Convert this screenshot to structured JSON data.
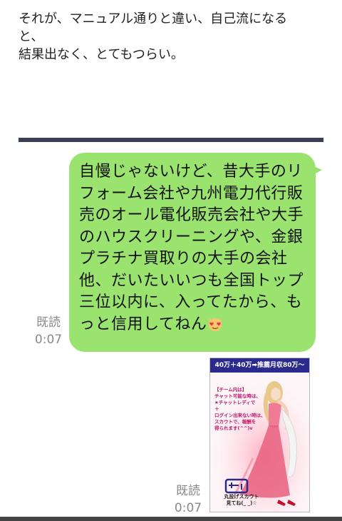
{
  "top_message": {
    "lines": [
      "それが、マニュアル通りと違い、自己流になる",
      "と、",
      "結果出なく、とてもつらい。"
    ]
  },
  "chat": {
    "bubble_message": "自慢じゃないけど、昔大手のリフォーム会社や九州電力代行販売のオール電化販売会社や大手のハウスクリーニングや、金銀プラチナ買取りの大手の会社他、だいたいいつも全国トップ三位以内に、入ってたから、もっと信用してねん",
    "bubble_emoji": "heart-eyes-cat-emoji",
    "bubble_read_label": "既読",
    "bubble_time": "0:07",
    "image_read_label": "既読",
    "image_time": "0:07",
    "bubble_color": "#9be36f"
  },
  "image_card": {
    "banner": "40万＋40万➡推薦月収80万〜",
    "note_lines": [
      "【チーム内は】",
      "チャット可能な時は、",
      "★チャットレディで",
      "＋",
      "ログイン出来ない時は、",
      "スカウトで、報酬を",
      "得られます(^^)v"
    ],
    "footer_lines": [
      "丸投げスカウト",
      "見てね(_ _)☆"
    ],
    "banner_color": "#2a2a8c",
    "dress_color": "#e8607f"
  }
}
